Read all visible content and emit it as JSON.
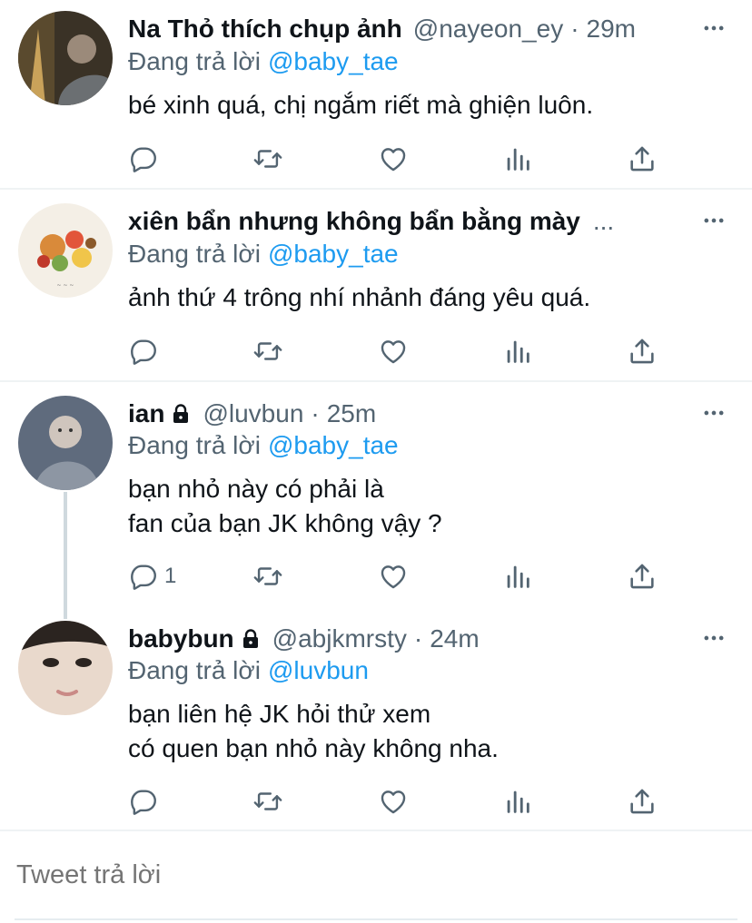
{
  "colors": {
    "link": "#1d9bf0",
    "muted": "#536471",
    "text": "#0f1419",
    "divider": "#eff3f4"
  },
  "replying_label": "Đang trả lời",
  "tweets": [
    {
      "name": "Na Thỏ thích chụp ảnh",
      "handle": "@nayeon_ey",
      "dot": "·",
      "time": "29m",
      "reply_to": "@baby_tae",
      "text": "bé xinh quá, chị ngắm riết mà ghiện luôn.",
      "reply_count": ""
    },
    {
      "name": "xiên bẩn nhưng không bẩn bằng mày",
      "ellipsis": "...",
      "reply_to": "@baby_tae",
      "text": "ảnh thứ 4 trông nhí nhảnh đáng yêu quá.",
      "reply_count": ""
    },
    {
      "name": "ian",
      "handle": "@luvbun",
      "dot": "·",
      "time": "25m",
      "reply_to": "@baby_tae",
      "text": "bạn nhỏ này có phải là\nfan của bạn JK không vậy ?",
      "reply_count": "1"
    },
    {
      "name": "babybun",
      "handle": "@abjkmrsty",
      "dot": "·",
      "time": "24m",
      "reply_to": "@luvbun",
      "text": "bạn liên hệ JK hỏi thử xem\ncó quen bạn nhỏ này không nha.",
      "reply_count": ""
    }
  ],
  "reply_box": {
    "placeholder": "Tweet trả lời"
  },
  "icons": [
    "reply-icon",
    "retweet-icon",
    "like-icon",
    "analytics-icon",
    "share-icon",
    "more-icon",
    "lock-icon"
  ]
}
